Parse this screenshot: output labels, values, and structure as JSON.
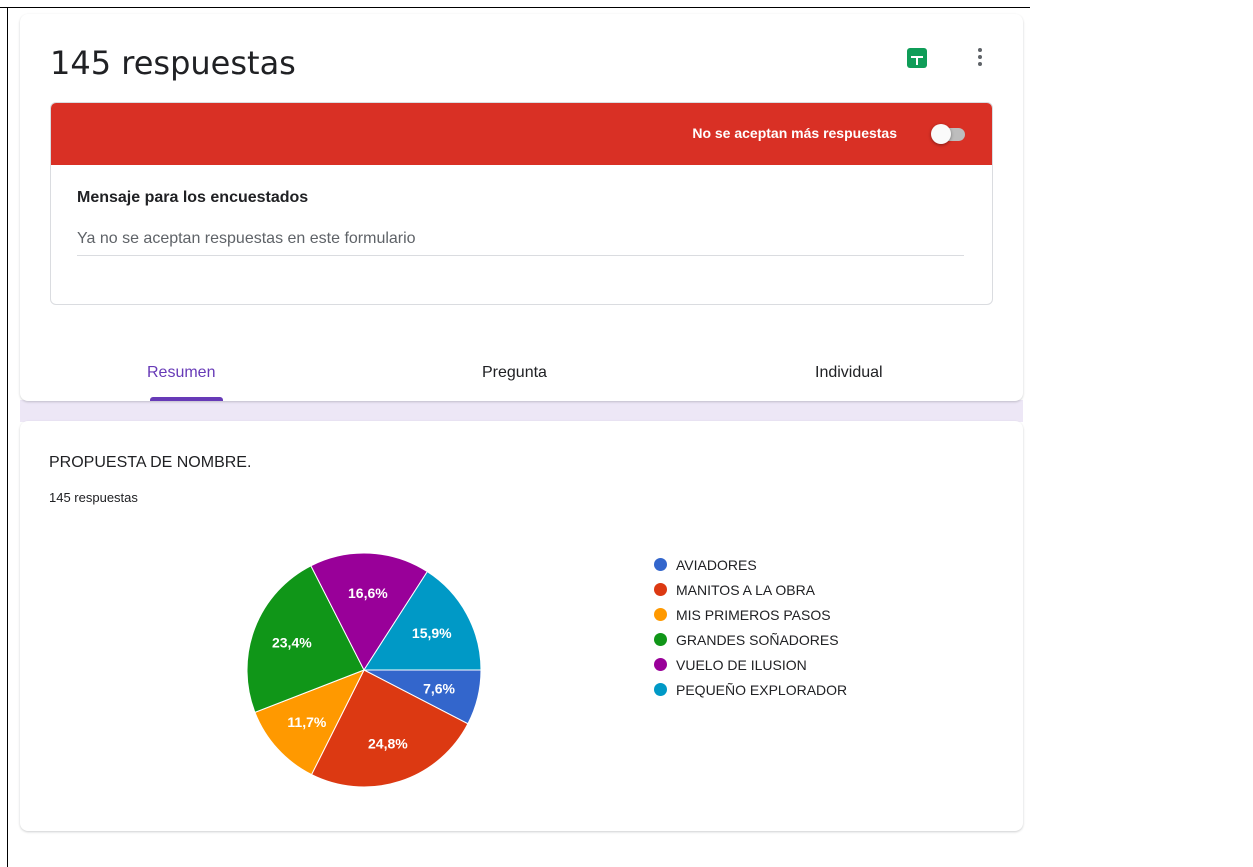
{
  "header": {
    "title": "145 respuestas",
    "sheets_icon": "google-sheets-icon",
    "more_icon": "more-vert-icon"
  },
  "accepting": {
    "label": "No se aceptan más respuestas",
    "toggle_on": false,
    "bar_color": "#d93025",
    "message_label": "Mensaje para los encuestados",
    "message_value": "Ya no se aceptan respuestas en este formulario"
  },
  "tabs": [
    {
      "label": "Resumen",
      "active": true
    },
    {
      "label": "Pregunta",
      "active": false
    },
    {
      "label": "Individual",
      "active": false
    }
  ],
  "accent_color": "#673ab7",
  "question": {
    "title": "PROPUESTA DE NOMBRE.",
    "count": "145 respuestas"
  },
  "chart_data": {
    "type": "pie",
    "categories": [
      "AVIADORES",
      "MANITOS A LA OBRA",
      "MIS PRIMEROS PASOS",
      "GRANDES SOÑADORES",
      "VUELO DE ILUSION",
      "PEQUEÑO EXPLORADOR"
    ],
    "values": [
      7.6,
      24.8,
      11.7,
      23.4,
      16.6,
      15.9
    ],
    "labels": [
      "7,6%",
      "24,8%",
      "11,7%",
      "23,4%",
      "16,6%",
      "15,9%"
    ],
    "colors": [
      "#3366cc",
      "#dc3912",
      "#ff9900",
      "#109618",
      "#990099",
      "#0099c6"
    ],
    "legend_position": "right"
  }
}
